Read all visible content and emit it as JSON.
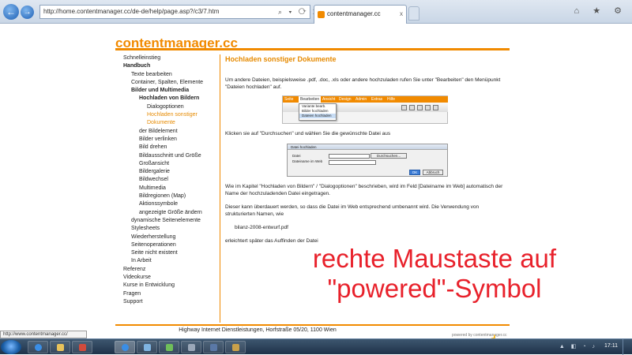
{
  "browser": {
    "url": "http://home.contentmanager.cc/de-de/help/page.asp?/c3/7.htm",
    "back": "←",
    "forward": "→",
    "address_icons": "⌕ ▾ ⟳ ✕",
    "tab_title": "contentmanager.cc",
    "tab_close": "x",
    "tools": "⌂ ★ ⚙",
    "status_url": "http://www.contentmanager.cc/"
  },
  "site": {
    "title": "contentmanager.cc",
    "footer": "Highway Internet Dienstleistungen, Horfstraße 05/20, 1100 Wien",
    "powered": "powered by contentmanager.cc"
  },
  "sidebar": {
    "items": [
      {
        "label": "Schnelleinstieg",
        "level": 0
      },
      {
        "label": "Handbuch",
        "level": 0,
        "bold": true
      },
      {
        "label": "Texte bearbeiten",
        "level": 1
      },
      {
        "label": "Container, Spalten, Elemente",
        "level": 1
      },
      {
        "label": "Bilder und Multimedia",
        "level": 1,
        "bold": true
      },
      {
        "label": "Hochladen von Bildern",
        "level": 2,
        "bold": true
      },
      {
        "label": "Dialogoptionen",
        "level": 3
      },
      {
        "label": "Hochladen sonstiger",
        "level": 3,
        "active": true
      },
      {
        "label": "Dokumente",
        "level": 3,
        "active": true
      },
      {
        "label": "der Bildelement",
        "level": 2
      },
      {
        "label": "Bilder verlinken",
        "level": 2
      },
      {
        "label": "Bild drehen",
        "level": 2
      },
      {
        "label": "Bildausschnitt und Größe",
        "level": 2
      },
      {
        "label": "Großansicht",
        "level": 2
      },
      {
        "label": "Bildergalerie",
        "level": 2
      },
      {
        "label": "Bildwechsel",
        "level": 2
      },
      {
        "label": "Multimedia",
        "level": 2
      },
      {
        "label": "Bildregionen (Map)",
        "level": 2
      },
      {
        "label": "Aktionssymbole",
        "level": 2
      },
      {
        "label": "angezeigte Größe ändern",
        "level": 2
      },
      {
        "label": "dynamische Seitenelemente",
        "level": 1
      },
      {
        "label": "Stylesheets",
        "level": 1
      },
      {
        "label": "Wiederherstellung",
        "level": 1
      },
      {
        "label": "Seitenoperationen",
        "level": 1
      },
      {
        "label": "Seite nicht existent",
        "level": 1
      },
      {
        "label": "In Arbeit",
        "level": 1
      },
      {
        "label": "Referenz",
        "level": 0
      },
      {
        "label": "Videokurse",
        "level": 0
      },
      {
        "label": "Kurse in Entwicklung",
        "level": 0
      },
      {
        "label": "Fragen",
        "level": 0
      },
      {
        "label": "Support",
        "level": 0
      }
    ]
  },
  "main": {
    "heading": "Hochladen sonstiger Dokumente",
    "p1": "Um andere Dateien, beispielsweise .pdf, .doc, .xls oder andere hochzuladen rufen Sie unter \"Bearbeiten\" den Menüpunkt \"Dateien hochladen\" auf.",
    "p2": "Klicken sie auf \"Durchsuchen\" und wählen Sie die gewünschte Datei aus",
    "p3": "Wie im Kapitel \"Hochladen von Bildern\" / \"Dialogoptionen\" beschrieben, wird im Feld [Dateiname im Web] automatisch der Name der hochzuladenden Datei eingetragen.",
    "p4": "Dieser kann überdauert werden, so dass die Datei im Web entsprechend umbenannt wird. Die Verwendung von strukturierten Namen, wie",
    "code": "bilanz-2008-entwurf.pdf",
    "p5": "erleichtert später das Auffinden der Datei",
    "shot1": {
      "menu": [
        "Seite",
        "Bearbeiten",
        "Ansicht",
        "Design",
        "Admin",
        "Extras",
        "Hilfe"
      ],
      "dropdown": [
        "Variante bearb.",
        "Bilder hochladen",
        "Dateien hochladen"
      ]
    },
    "shot2": {
      "title": "Datei hochladen",
      "label_file": "Datei",
      "label_web": "Dateiname im Web",
      "browse": "Durchsuchen...",
      "ok": "OK",
      "cancel": "Abbruch"
    }
  },
  "overlay": {
    "line1": "rechte Maustaste auf",
    "line2": "\"powered\"-Symbol"
  },
  "taskbar": {
    "tray": "▲ ◧ ◔ ♪",
    "clock": "17:11"
  }
}
